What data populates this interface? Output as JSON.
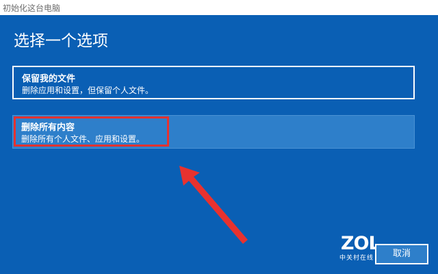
{
  "window": {
    "title": "初始化这台电脑"
  },
  "page": {
    "title": "选择一个选项"
  },
  "options": [
    {
      "label": "保留我的文件",
      "description": "删除应用和设置，但保留个人文件。"
    },
    {
      "label": "删除所有内容",
      "description": "删除所有个人文件、应用和设置。"
    }
  ],
  "footer": {
    "cancel_label": "取消"
  },
  "watermark": {
    "logo": "ZOL",
    "subtitle": "中关村在线"
  },
  "colors": {
    "background": "#0a5fb4",
    "selected_option": "#2e7fca",
    "highlight": "#e8322f"
  },
  "icons": {
    "annotation_arrow": "arrow-icon"
  }
}
